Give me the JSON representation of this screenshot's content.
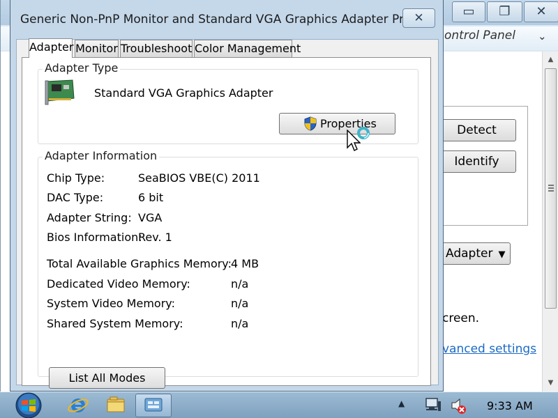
{
  "background_window": {
    "caption_buttons": {
      "minimize": "▭",
      "maximize": "❐",
      "close": "✕"
    },
    "address_text": "ontrol Panel",
    "detect_label": "Detect",
    "identify_label": "Identify",
    "adapter_dropdown_label": "Adapter",
    "screen_text": "creen.",
    "advanced_link": "vanced settings"
  },
  "dialog": {
    "title": "Generic Non-PnP Monitor and Standard VGA Graphics Adapter Pro...",
    "close_glyph": "✕",
    "tabs": [
      {
        "label": "Adapter",
        "active": true
      },
      {
        "label": "Monitor",
        "active": false
      },
      {
        "label": "Troubleshoot",
        "active": false
      },
      {
        "label": "Color Management",
        "active": false
      }
    ],
    "adapter_type": {
      "group_title": "Adapter Type",
      "name": "Standard VGA Graphics Adapter",
      "properties_label": "Properties",
      "icon": "graphics-card-icon"
    },
    "adapter_info": {
      "group_title": "Adapter Information",
      "rows": [
        {
          "label": "Chip Type:",
          "value": "SeaBIOS VBE(C) 2011"
        },
        {
          "label": "DAC Type:",
          "value": "6 bit"
        },
        {
          "label": "Adapter String:",
          "value": "VGA"
        },
        {
          "label": "Bios Information:",
          "value": "Rev. 1"
        }
      ],
      "memory_rows": [
        {
          "label": "Total Available Graphics Memory:",
          "value": "4 MB"
        },
        {
          "label": "Dedicated Video Memory:",
          "value": "n/a"
        },
        {
          "label": "System Video Memory:",
          "value": "n/a"
        },
        {
          "label": "Shared System Memory:",
          "value": "n/a"
        }
      ]
    },
    "list_all_modes_label": "List All Modes"
  },
  "taskbar": {
    "items": [
      "start-orb",
      "internet-explorer-icon",
      "windows-explorer-icon",
      "control-panel-icon"
    ],
    "clock": "9:33 AM"
  },
  "colors": {
    "title_bar": "#c5d8ea",
    "link": "#1a6ac6",
    "taskbar": "#8fb0cb"
  }
}
